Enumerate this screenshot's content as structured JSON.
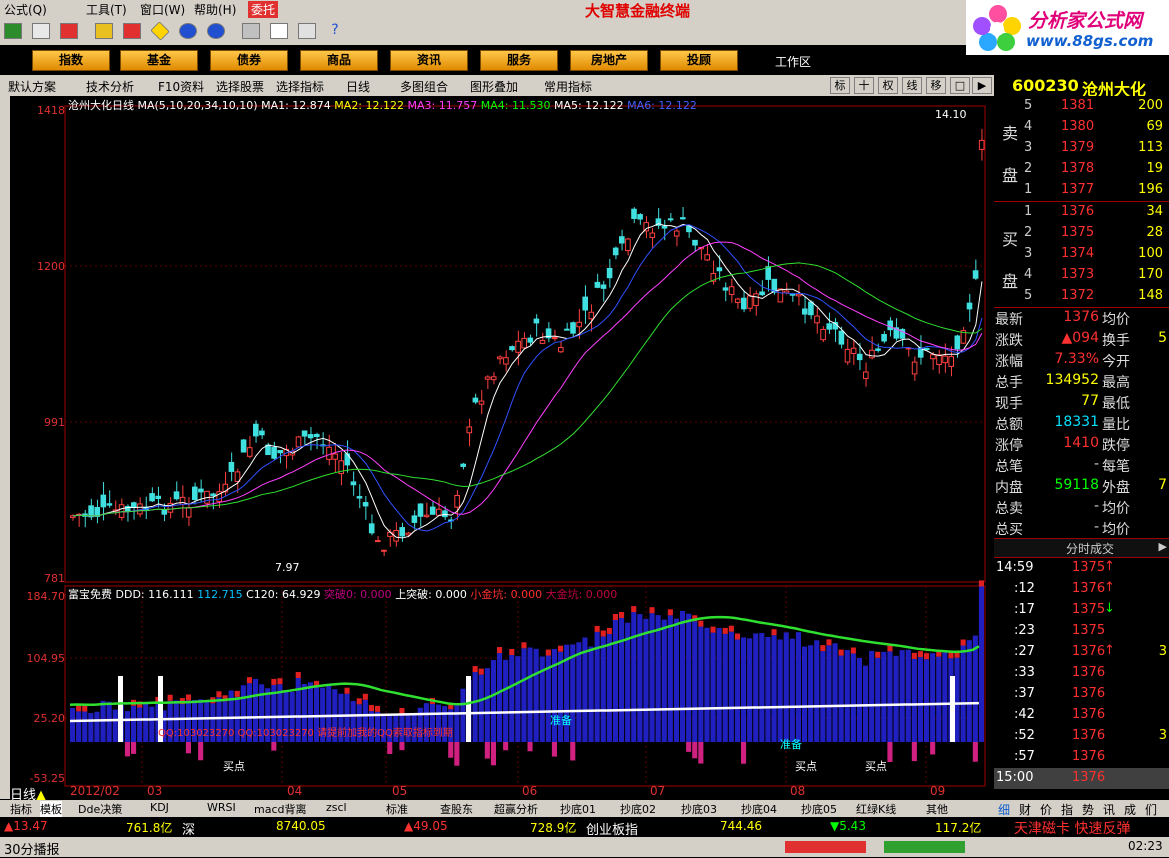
{
  "app": {
    "title": "大智慧金融终端"
  },
  "menu": [
    "公式(Q)",
    "工具(T)",
    "窗口(W)",
    "帮助(H)",
    "委托"
  ],
  "logo": {
    "text": "分析家公式网",
    "url_text": "www.88gs.com"
  },
  "categories": [
    "指数",
    "基金",
    "债券",
    "商品",
    "资讯",
    "服务",
    "房地产",
    "投顾"
  ],
  "workarea_label": "工作区",
  "toolbar2": {
    "items": [
      "默认方案",
      "技术分析",
      "F10资料",
      "选择股票",
      "选择指标",
      "日线",
      "多图组合",
      "图形叠加",
      "常用指标"
    ],
    "right_buttons": [
      "标",
      "十",
      "权",
      "线",
      "移"
    ]
  },
  "stock": {
    "code": "600230",
    "name": "沧州大化"
  },
  "main_chart": {
    "title": "沧州大化日线",
    "ma_label": "MA(5,10,20,34,10,10)",
    "ma_values": [
      {
        "label": "MA1: 12.874",
        "color": "#ffffff"
      },
      {
        "label": "MA2: 12.122",
        "color": "#ffff00"
      },
      {
        "label": "MA3: 11.757",
        "color": "#ff40ff"
      },
      {
        "label": "MA4: 11.530",
        "color": "#00ff00"
      },
      {
        "label": "MA5: 12.122",
        "color": "#ffffff"
      },
      {
        "label": "MA6: 12.122",
        "color": "#4060ff"
      }
    ],
    "y_ticks": [
      "1418",
      "1200",
      "991",
      "781"
    ],
    "high_label": "14.10",
    "low_label": "7.97"
  },
  "sub_chart": {
    "title": "富宝免费",
    "values": [
      {
        "label": "DDD: 116.111",
        "color": "#ffffff"
      },
      {
        "label": "112.715",
        "color": "#00c0ff"
      },
      {
        "label": "C120: 64.929",
        "color": "#ffffff"
      },
      {
        "label": "突破0: 0.000",
        "color": "#c00080"
      },
      {
        "label": "上突破: 0.000",
        "color": "#ffffff"
      },
      {
        "label": "小金坑: 0.000",
        "color": "#ff3030"
      },
      {
        "label": "大金坑: 0.000",
        "color": "#c00040"
      }
    ],
    "y_ticks": [
      "184.70",
      "104.95",
      "25.20",
      "-53.25"
    ],
    "annotation": "QQ:103023270    QQ:103023270    请提前加我的QQ索取指标到期",
    "markers": {
      "buy": "买点",
      "ready": "准备"
    }
  },
  "x_axis": [
    "2012/02",
    "03",
    "04",
    "05",
    "06",
    "07",
    "08",
    "09"
  ],
  "period_label": "日线",
  "order_book": {
    "sell_label": [
      "卖",
      "盘"
    ],
    "buy_label": [
      "买",
      "盘"
    ],
    "sells": [
      {
        "level": "5",
        "price": "1381",
        "vol": "200"
      },
      {
        "level": "4",
        "price": "1380",
        "vol": "69"
      },
      {
        "level": "3",
        "price": "1379",
        "vol": "113"
      },
      {
        "level": "2",
        "price": "1378",
        "vol": "19"
      },
      {
        "level": "1",
        "price": "1377",
        "vol": "196"
      }
    ],
    "buys": [
      {
        "level": "1",
        "price": "1376",
        "vol": "34"
      },
      {
        "level": "2",
        "price": "1375",
        "vol": "28"
      },
      {
        "level": "3",
        "price": "1374",
        "vol": "100"
      },
      {
        "level": "4",
        "price": "1373",
        "vol": "170"
      },
      {
        "level": "5",
        "price": "1372",
        "vol": "148"
      }
    ]
  },
  "stats": [
    {
      "l1": "最新",
      "v1": "1376",
      "c1": "#ff3030",
      "l2": "均价",
      "v2": ""
    },
    {
      "l1": "涨跌",
      "v1": "▲094",
      "c1": "#ff3030",
      "l2": "换手",
      "v2": "5"
    },
    {
      "l1": "涨幅",
      "v1": "7.33%",
      "c1": "#ff3030",
      "l2": "今开",
      "v2": ""
    },
    {
      "l1": "总手",
      "v1": "134952",
      "c1": "#ffff00",
      "l2": "最高",
      "v2": ""
    },
    {
      "l1": "现手",
      "v1": "77",
      "c1": "#ffff00",
      "l2": "最低",
      "v2": ""
    },
    {
      "l1": "总额",
      "v1": "18331",
      "c1": "#00e0ff",
      "l2": "量比",
      "v2": ""
    },
    {
      "l1": "涨停",
      "v1": "1410",
      "c1": "#ff3030",
      "l2": "跌停",
      "v2": ""
    },
    {
      "l1": "总笔",
      "v1": "-",
      "c1": "#cccccc",
      "l2": "每笔",
      "v2": ""
    },
    {
      "l1": "内盘",
      "v1": "59118",
      "c1": "#00ff00",
      "l2": "外盘",
      "v2": "7"
    },
    {
      "l1": "总卖",
      "v1": "-",
      "c1": "#cccccc",
      "l2": "均价",
      "v2": ""
    },
    {
      "l1": "总买",
      "v1": "-",
      "c1": "#cccccc",
      "l2": "均价",
      "v2": ""
    }
  ],
  "ticks_header": "分时成交",
  "ticks": [
    {
      "time": "14:59",
      "price": "1375",
      "arrow": "↑",
      "ac": "#ff3030"
    },
    {
      "time": ":12",
      "price": "1376",
      "arrow": "↑",
      "ac": "#ff3030"
    },
    {
      "time": ":17",
      "price": "1375",
      "arrow": "↓",
      "ac": "#00ff00"
    },
    {
      "time": ":23",
      "price": "1375",
      "arrow": "",
      "ac": "#ff3030"
    },
    {
      "time": ":27",
      "price": "1376",
      "arrow": "↑",
      "ac": "#ff3030",
      "extra": "3"
    },
    {
      "time": ":33",
      "price": "1376",
      "arrow": "",
      "ac": "#ff3030"
    },
    {
      "time": ":37",
      "price": "1376",
      "arrow": "",
      "ac": "#ff3030"
    },
    {
      "time": ":42",
      "price": "1376",
      "arrow": "",
      "ac": "#ff3030"
    },
    {
      "time": ":52",
      "price": "1376",
      "arrow": "",
      "ac": "#ff3030",
      "extra": "3"
    },
    {
      "time": ":57",
      "price": "1376",
      "arrow": "",
      "ac": "#ff3030"
    },
    {
      "time": "15:00",
      "price": "1376",
      "arrow": "",
      "ac": "#ff3030"
    }
  ],
  "bottom_tabs": [
    "指标",
    "模板",
    "Dde决策",
    "KDJ",
    "WRSI",
    "macd背离",
    "zscl",
    "标准",
    "查股东",
    "超赢分析",
    "抄底01",
    "抄底02",
    "抄底03",
    "抄底04",
    "抄底05",
    "红绿K线",
    "其他"
  ],
  "right_tabs": [
    "细",
    "财",
    "价",
    "指",
    "势",
    "讯",
    "成",
    "们"
  ],
  "ticker": [
    {
      "text": "▲13.47",
      "color": "#ff3030"
    },
    {
      "text": "761.8亿",
      "color": "#ffff00"
    },
    {
      "text": "深",
      "color": "#ffffff"
    },
    {
      "text": "8740.05",
      "color": "#ffff00"
    },
    {
      "text": "▲49.05",
      "color": "#ff3030"
    },
    {
      "text": "728.9亿",
      "color": "#ffff00"
    },
    {
      "text": "创业板指",
      "color": "#ffffff"
    },
    {
      "text": "744.46",
      "color": "#ffff00"
    },
    {
      "text": "▼5.43",
      "color": "#00ff00"
    },
    {
      "text": "117.2亿",
      "color": "#ffff00"
    }
  ],
  "ticker_news": "天津磁卡 快速反弹",
  "status": {
    "left": "30分播报",
    "time": "02:23"
  }
}
